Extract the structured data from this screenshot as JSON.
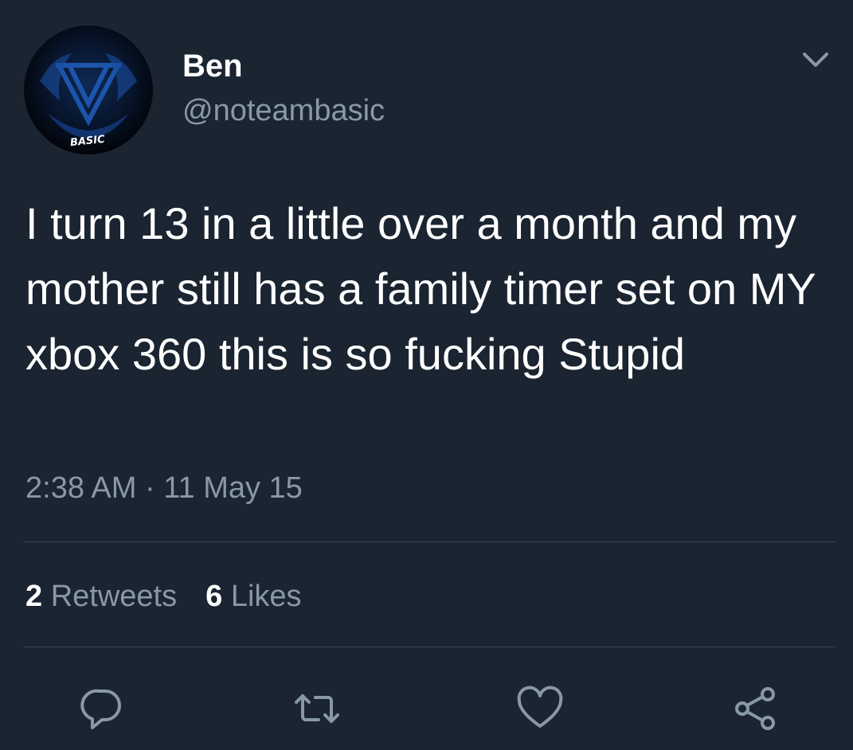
{
  "user": {
    "display_name": "Ben",
    "handle": "@noteambasic",
    "avatar_text": "BASIC"
  },
  "tweet": {
    "text": "I turn 13 in a little over a month and my mother still has a family timer set on MY xbox 360 this is so fucking Stupid",
    "timestamp": "2:38 AM · 11 May 15"
  },
  "stats": {
    "retweets_count": "2",
    "retweets_label": "Retweets",
    "likes_count": "6",
    "likes_label": "Likes"
  },
  "actions": {
    "icons": [
      "reply-icon",
      "retweet-icon",
      "like-icon",
      "share-icon"
    ]
  },
  "colors": {
    "background": "#1b2431",
    "text": "#ffffff",
    "secondary_text": "#8899a6",
    "divider": "#38444d"
  }
}
